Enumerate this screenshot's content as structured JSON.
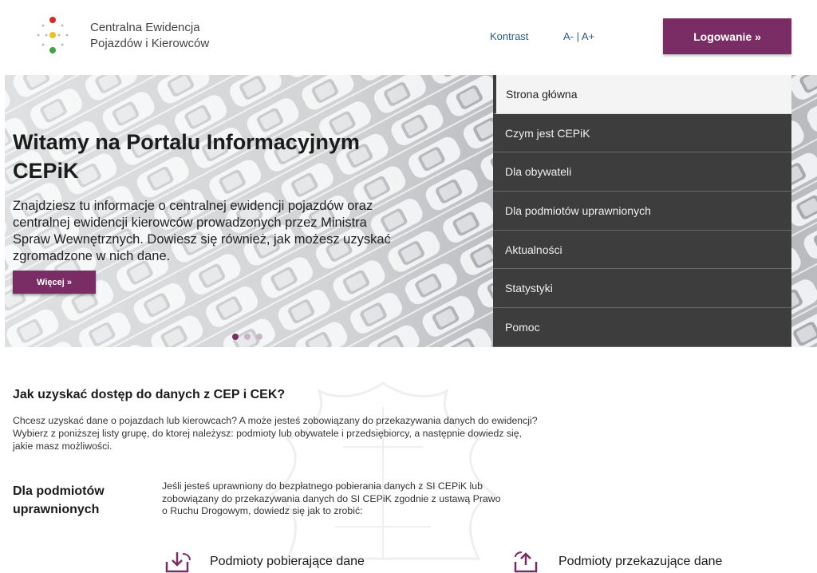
{
  "header": {
    "logo_line1": "Centralna Ewidencja",
    "logo_line2": "Pojazdów i Kierowców",
    "logo_icon": "traffic-light-dots-icon",
    "contrast_label": "Kontrast",
    "font_decrease": "A-",
    "font_separator": "|",
    "font_increase": "A+",
    "login_label": "Logowanie »"
  },
  "hero": {
    "title": "Witamy na Portalu Informacyjnym CEPiK",
    "text": "Znajdziesz tu informacje o centralnej ewidencji pojazdów oraz centralnej ewidencji kierowców prowadzonych przez Ministra Spraw Wewnętrznych. Dowiesz się również, jak możesz uzyskać zgromadzone w nich dane.",
    "more_label": "Więcej »",
    "slides_count": 3,
    "active_slide": 1
  },
  "menu": {
    "items": [
      {
        "label": "Strona główna",
        "active": true
      },
      {
        "label": "Czym jest CEPiK",
        "active": false
      },
      {
        "label": "Dla obywateli",
        "active": false
      },
      {
        "label": "Dla podmiotów uprawnionych",
        "active": false
      },
      {
        "label": "Aktualności",
        "active": false
      },
      {
        "label": "Statystyki",
        "active": false
      },
      {
        "label": "Pomoc",
        "active": false
      }
    ]
  },
  "access": {
    "title": "Jak uzyskać dostęp do danych z CEP i CEK?",
    "text": "Chcesz uzyskać dane o pojazdach lub kierowcach? A może jesteś zobowiązany do przekazywania danych do ewidencji? Wybierz z poniższej listy grupę, do ktorej należysz: podmioty lub obywatele i przedsiębiorcy, a następnie dowiedz się, jakie masz możliwości."
  },
  "group": {
    "title": "Dla podmiotów uprawnionych",
    "text": "Jeśli jesteś uprawniony do bezpłatnego pobierania danych z SI CEPiK lub zobowiązany do przekazywania danych do SI CEPiK zgodnie z ustawą Prawo o Ruchu Drogowym, dowiedz się jak to zrobić:",
    "item1": "Podmioty pobierające dane",
    "item1_icon": "download-data-icon",
    "item2": "Podmioty przekazujące dane",
    "item2_icon": "transfer-data-icon"
  },
  "colors": {
    "accent": "#7a2d64",
    "menu_bg": "#3d3d3d",
    "link": "#2a5a8a"
  }
}
